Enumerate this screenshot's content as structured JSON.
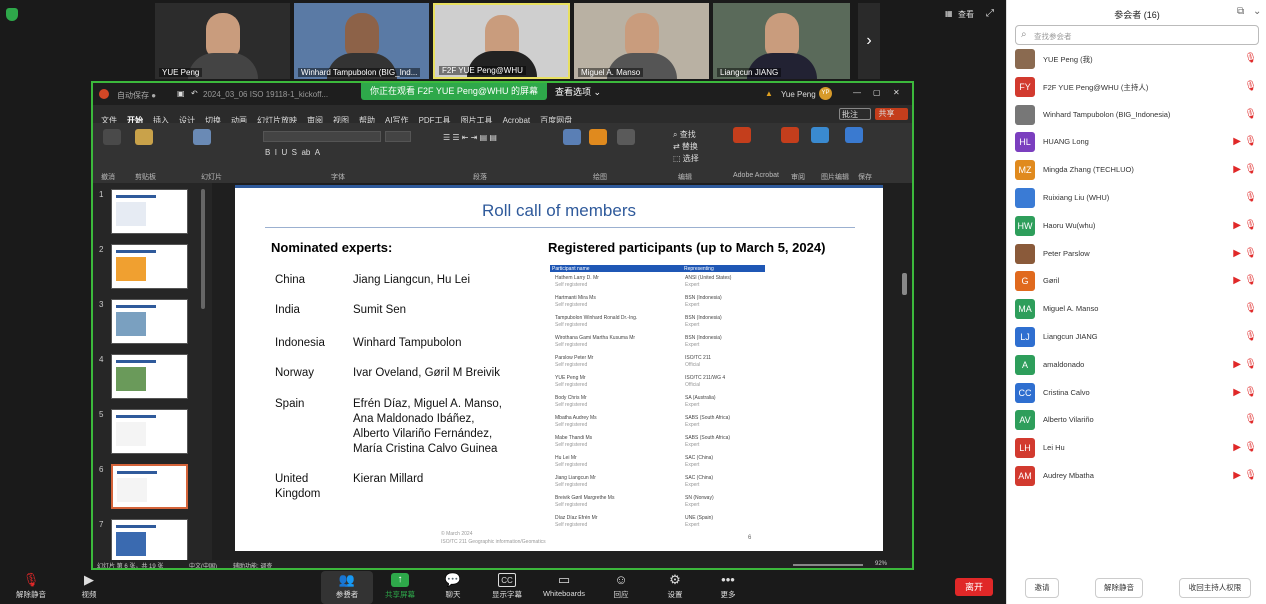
{
  "top_bar": {
    "view_label": "查看",
    "tiles": [
      {
        "name": "YUE Peng",
        "mic_off": true
      },
      {
        "name": "Winhard Tampubolon (BIG_Ind...",
        "mic_off": true
      },
      {
        "name": "F2F YUE Peng@WHU",
        "mic_off": true
      },
      {
        "name": "Miguel A. Manso",
        "mic_off": true
      },
      {
        "name": "Liangcun JIANG",
        "mic_off": true
      }
    ]
  },
  "share": {
    "banner": "你正在观看 F2F YUE Peng@WHU 的屏幕",
    "view_options": "查看选项",
    "title_text": "2024_03_06 ISO 19118-1_kickoff...",
    "user": "Yue Peng",
    "user_initials": "YP",
    "comment_btn": "批注",
    "share_btn": "共享"
  },
  "ppt": {
    "menu": [
      "文件",
      "开始",
      "插入",
      "设计",
      "切换",
      "动画",
      "幻灯片放映",
      "审阅",
      "视图",
      "帮助",
      "AI写作",
      "PDF工具",
      "图片工具",
      "Acrobat",
      "百度网盘"
    ],
    "groups": [
      "撤消",
      "剪贴板",
      "幻灯片",
      "字体",
      "段落",
      "绘图",
      "编辑",
      "Adobe Acrobat",
      "审阅",
      "图片编辑",
      "保存"
    ],
    "status_left": "幻灯片 第 6 张，共 19 张",
    "status_lang": "中文(中国)",
    "status_accessibility": "辅助功能: 调查",
    "zoom": "92%"
  },
  "slide": {
    "title": "Roll call of members",
    "left_heading": "Nominated experts:",
    "right_heading": "Registered participants (up to March 5, 2024)",
    "experts": [
      {
        "country": "China",
        "names": "Jiang Liangcun, Hu Lei"
      },
      {
        "country": "India",
        "names": "Sumit Sen"
      },
      {
        "country": "Indonesia",
        "names": "Winhard Tampubolon"
      },
      {
        "country": "Norway",
        "names": "Ivar Oveland, Gøril M Breivik"
      },
      {
        "country": "Spain",
        "names": "Efrén Díaz, Miguel A. Manso,\nAna Maldonado Ibáñez,\nAlberto Vilariño Fernández,\nMaría Cristina Calvo Guinea"
      },
      {
        "country": "United\nKingdom",
        "names": "Kieran Millard"
      }
    ],
    "reg_header": {
      "col1": "Participant name",
      "col2": "Representing"
    },
    "registered": [
      {
        "name": "Hathem Larry D. Mr",
        "status": "Self registered",
        "rep": "ANSI (United States)",
        "role": "Expert"
      },
      {
        "name": "Hartmanti Mira Ms",
        "status": "Self registered",
        "rep": "BSN (Indonesia)",
        "role": "Expert"
      },
      {
        "name": "Tampubolon Winhard Ronald Dr.-Ing.",
        "status": "Self registered",
        "rep": "BSN (Indonesia)",
        "role": "Expert"
      },
      {
        "name": "Wirothana Gami Martha Kusuma Mr",
        "status": "Self registered",
        "rep": "BSN (Indonesia)",
        "role": "Expert"
      },
      {
        "name": "Parslow Peter Mr",
        "status": "Self registered",
        "rep": "ISO/TC 211",
        "role": "Official"
      },
      {
        "name": "YUE Peng Mr",
        "status": "Self registered",
        "rep": "ISO/TC 211/WG 4",
        "role": "Official"
      },
      {
        "name": "Body Chris Mr",
        "status": "Self registered",
        "rep": "SA (Australia)",
        "role": "Expert"
      },
      {
        "name": "Mbatha Audrey Ms",
        "status": "Self registered",
        "rep": "SABS (South Africa)",
        "role": "Expert"
      },
      {
        "name": "Mabe Thandi Ms",
        "status": "Self registered",
        "rep": "SABS (South Africa)",
        "role": "Expert"
      },
      {
        "name": "Hu Lei Mr",
        "status": "Self registered",
        "rep": "SAC (China)",
        "role": "Expert"
      },
      {
        "name": "Jiang Liangcun Mr",
        "status": "Self registered",
        "rep": "SAC (China)",
        "role": "Expert"
      },
      {
        "name": "Breivik Gøril Margrethe Ms",
        "status": "Self registered",
        "rep": "SN (Norway)",
        "role": "Expert"
      },
      {
        "name": "Díaz Díaz Efrén Mr",
        "status": "Self registered",
        "rep": "UNE (Spain)",
        "role": "Expert"
      }
    ],
    "footer_1": "© March 2024",
    "footer_2": "ISO/TC 211 Geographic information/Geomatics",
    "page_num": "6"
  },
  "thumbs": [
    "1",
    "2",
    "3",
    "4",
    "5",
    "6",
    "7"
  ],
  "bottom_bar": {
    "unmute": "解除静音",
    "video": "视频",
    "participants": "参会者",
    "participants_count": "16",
    "share": "共享屏幕",
    "chat": "聊天",
    "captions": "显示字幕",
    "whiteboards": "Whiteboards",
    "reactions": "回应",
    "settings": "设置",
    "more": "更多",
    "leave": "离开"
  },
  "participants_panel": {
    "title": "参会者 (16)",
    "search_placeholder": "查找参会者",
    "people": [
      {
        "name": "YUE Peng (我)",
        "initials": "",
        "color": "#8a6a50",
        "video_off": false
      },
      {
        "name": "F2F YUE Peng@WHU (主持人)",
        "initials": "FY",
        "color": "#d23a2f",
        "video_off": false
      },
      {
        "name": "Winhard Tampubolon (BIG_Indonesia)",
        "initials": "",
        "color": "#777",
        "video_off": false
      },
      {
        "name": "HUANG Long",
        "initials": "HL",
        "color": "#7b3fbf",
        "video_off": true
      },
      {
        "name": "Mingda Zhang (TECHLUO)",
        "initials": "MZ",
        "color": "#e08a1e",
        "video_off": true
      },
      {
        "name": "Ruixiang Liu (WHU)",
        "initials": "",
        "color": "#3a7bd5",
        "video_off": false
      },
      {
        "name": "Haoru Wu(whu)",
        "initials": "HW",
        "color": "#2e9e5b",
        "video_off": true
      },
      {
        "name": "Peter Parslow",
        "initials": "",
        "color": "#8a5a3a",
        "video_off": true
      },
      {
        "name": "Gøril",
        "initials": "G",
        "color": "#e06a1e",
        "video_off": true
      },
      {
        "name": "Miguel A. Manso",
        "initials": "MA",
        "color": "#2e9e5b",
        "video_off": false
      },
      {
        "name": "Liangcun JIANG",
        "initials": "LJ",
        "color": "#2f6fd0",
        "video_off": false
      },
      {
        "name": "amaldonado",
        "initials": "A",
        "color": "#2e9e5b",
        "video_off": true
      },
      {
        "name": "Cristina Calvo",
        "initials": "CC",
        "color": "#2f6fd0",
        "video_off": true
      },
      {
        "name": "Alberto Vilariño",
        "initials": "AV",
        "color": "#2e9e5b",
        "video_off": false
      },
      {
        "name": "Lei Hu",
        "initials": "LH",
        "color": "#d23a2f",
        "video_off": true
      },
      {
        "name": "Audrey Mbatha",
        "initials": "AM",
        "color": "#d23a2f",
        "video_off": true
      }
    ],
    "invite": "邀请",
    "unmute_all": "解除静音",
    "reclaim_host": "收回主持人权限"
  }
}
